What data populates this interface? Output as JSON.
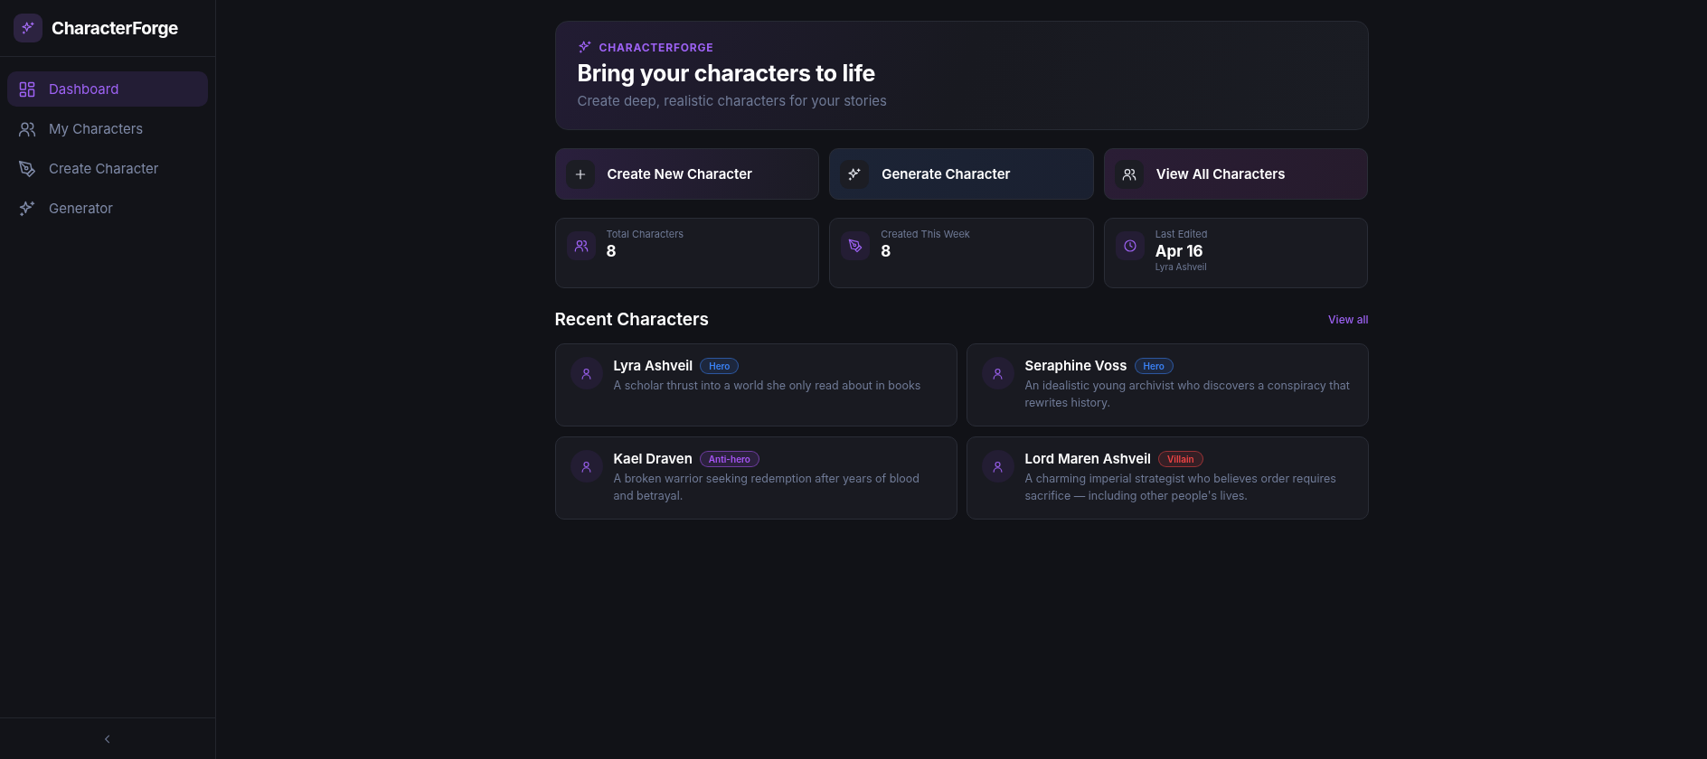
{
  "sidebar": {
    "brand": "CharacterForge",
    "items": [
      {
        "label": "Dashboard",
        "kind": "dashboard",
        "selected": true
      },
      {
        "label": "My Characters",
        "kind": "characters",
        "selected": false
      },
      {
        "label": "Create Character",
        "kind": "create",
        "selected": false
      },
      {
        "label": "Generator",
        "kind": "generator",
        "selected": false
      }
    ]
  },
  "hero": {
    "eyebrow": "CHARACTERFORGE",
    "title": "Bring your characters to life",
    "subtitle": "Create deep, realistic characters for your stories"
  },
  "actions": [
    {
      "label": "Create New Character",
      "kind": "create"
    },
    {
      "label": "Generate Character",
      "kind": "generate"
    },
    {
      "label": "View All Characters",
      "kind": "browse"
    }
  ],
  "stats": [
    {
      "label": "Total Characters",
      "value": "8",
      "kind": "users"
    },
    {
      "label": "Created This Week",
      "value": "8",
      "kind": "pen"
    },
    {
      "label": "Last Edited",
      "value": "Apr 16",
      "note": "Lyra Ashveil",
      "kind": "clock"
    }
  ],
  "recent": {
    "title": "Recent Characters",
    "link": "View all",
    "characters": [
      {
        "name": "Lyra Ashveil",
        "tag": "Hero",
        "color": "#3b82f6",
        "description": "A scholar thrust into a world she only read about in books"
      },
      {
        "name": "Seraphine Voss",
        "tag": "Hero",
        "color": "#3b82f6",
        "description": "An idealistic young archivist who discovers a conspiracy that rewrites history."
      },
      {
        "name": "Kael Draven",
        "tag": "Anti-hero",
        "color": "#a855f7",
        "description": "A broken warrior seeking redemption after years of blood and betrayal."
      },
      {
        "name": "Lord Maren Ashveil",
        "tag": "Villain",
        "color": "#ef4444",
        "description": "A charming imperial strategist who believes order requires sacrifice — including other people's lives."
      }
    ]
  }
}
